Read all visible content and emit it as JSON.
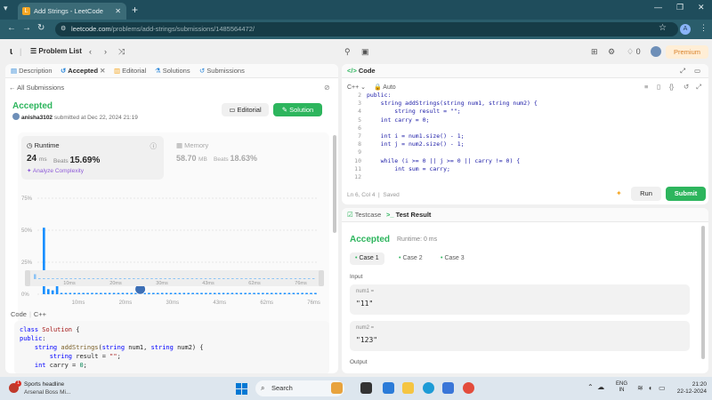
{
  "browser": {
    "tab_title": "Add Strings - LeetCode",
    "url_host": "leetcode.com",
    "url_path": "/problems/add-strings/submissions/1485564472/",
    "profile_initial": "A"
  },
  "topbar": {
    "problem_list": "Problem List",
    "premium": "Premium",
    "streak": "0"
  },
  "left_tabs": [
    "Description",
    "Accepted",
    "Editorial",
    "Solutions",
    "Submissions"
  ],
  "submission": {
    "back": "All Submissions",
    "status": "Accepted",
    "user": "anisha3102",
    "submitted": "submitted at Dec 22, 2024 21:19",
    "editorial_btn": "Editorial",
    "solution_btn": "Solution"
  },
  "runtime": {
    "title": "Runtime",
    "value": "24",
    "unit": "ms",
    "beats_label": "Beats",
    "beats": "15.69%",
    "analyze": "Analyze Complexity"
  },
  "memory": {
    "title": "Memory",
    "value": "58.70",
    "unit": "MB",
    "beats_label": "Beats",
    "beats": "18.63%"
  },
  "chart_data": {
    "type": "bar",
    "ylim": [
      0,
      75
    ],
    "yticks": [
      "75%",
      "50%",
      "25%",
      "0%"
    ],
    "xticks": [
      "10ms",
      "20ms",
      "30ms",
      "43ms",
      "62ms",
      "76ms"
    ],
    "values": [
      52,
      4,
      3,
      8,
      1,
      1,
      1,
      1,
      1,
      1,
      1,
      1,
      1,
      1,
      1,
      1,
      1,
      1,
      1,
      1,
      1,
      1,
      1,
      1,
      1,
      1,
      1,
      1,
      1,
      1,
      1,
      1,
      1,
      1,
      1,
      1,
      1,
      1,
      1,
      1,
      1,
      1,
      1,
      1,
      1,
      1,
      1,
      1,
      1,
      1,
      1,
      1,
      1,
      1,
      1,
      1,
      1,
      1,
      1,
      1,
      1,
      1,
      1
    ],
    "user_bar_index": 22,
    "colors": {
      "bar": "#1a90ff",
      "bar_faint": "#8cc3f5"
    }
  },
  "code_section": {
    "label": "Code",
    "lang": "C++",
    "lines": [
      "class Solution {",
      "public:",
      "    string addStrings(string num1, string num2) {",
      "        string result = \"\";",
      "    int carry = 0;"
    ]
  },
  "editor": {
    "title": "Code",
    "lang": "C++",
    "auto": "Auto",
    "lines": [
      {
        "n": "2",
        "t": "public:"
      },
      {
        "n": "3",
        "t": "    string addStrings(string num1, string num2) {"
      },
      {
        "n": "4",
        "t": "        string result = \"\";"
      },
      {
        "n": "5",
        "t": "    int carry = 0;"
      },
      {
        "n": "6",
        "t": ""
      },
      {
        "n": "7",
        "t": "    int i = num1.size() - 1;"
      },
      {
        "n": "8",
        "t": "    int j = num2.size() - 1;"
      },
      {
        "n": "9",
        "t": ""
      },
      {
        "n": "10",
        "t": "    while (i >= 0 || j >= 0 || carry != 0) {"
      },
      {
        "n": "11",
        "t": "        int sum = carry;"
      },
      {
        "n": "12",
        "t": ""
      }
    ],
    "status": "Ln 6, Col 4",
    "saved": "Saved",
    "run": "Run",
    "submit": "Submit"
  },
  "result": {
    "tab_testcase": "Testcase",
    "tab_result": "Test Result",
    "status": "Accepted",
    "runtime": "Runtime: 0 ms",
    "cases": [
      "Case 1",
      "Case 2",
      "Case 3"
    ],
    "input_label": "Input",
    "inputs": [
      {
        "name": "num1 =",
        "value": "\"11\""
      },
      {
        "name": "num2 =",
        "value": "\"123\""
      }
    ],
    "output_label": "Output"
  },
  "taskbar": {
    "news_title": "Sports headline",
    "news_sub": "Arsenal Boss Mi...",
    "search": "Search",
    "lang1": "ENG",
    "lang2": "IN",
    "time": "21:20",
    "date": "22-12-2024"
  }
}
